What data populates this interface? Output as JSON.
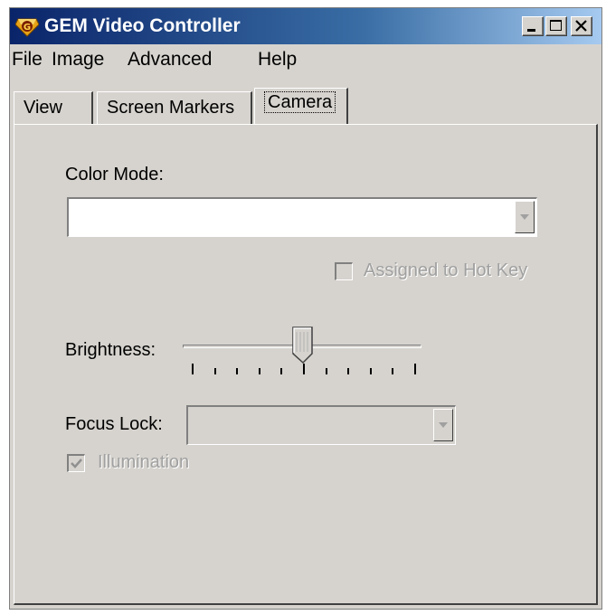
{
  "window": {
    "title": "GEM Video Controller",
    "icon": "gem-logo-icon",
    "controls": [
      "minimize-icon",
      "maximize-icon",
      "close-icon"
    ]
  },
  "menu": {
    "file": "File",
    "image": "Image",
    "advanced": "Advanced",
    "help": "Help"
  },
  "tabs": {
    "view": "View",
    "screen_markers": "Screen Markers",
    "camera": "Camera",
    "active": "Camera"
  },
  "camera": {
    "color_mode_label": "Color Mode:",
    "color_mode_value": "",
    "hot_key_label": "Assigned to Hot Key",
    "hot_key_checked": false,
    "hot_key_enabled": false,
    "brightness_label": "Brightness:",
    "brightness_level": 0.5,
    "focus_lock_label": "Focus Lock:",
    "focus_lock_value": "",
    "focus_lock_enabled": false,
    "illumination_label": "Illumination",
    "illumination_checked": true,
    "illumination_enabled": false
  },
  "colors": {
    "face": "#d6d3ce",
    "title_gradient_start": "#0a246a",
    "title_gradient_end": "#a6caf0",
    "disabled_text": "#a0a0a0"
  }
}
